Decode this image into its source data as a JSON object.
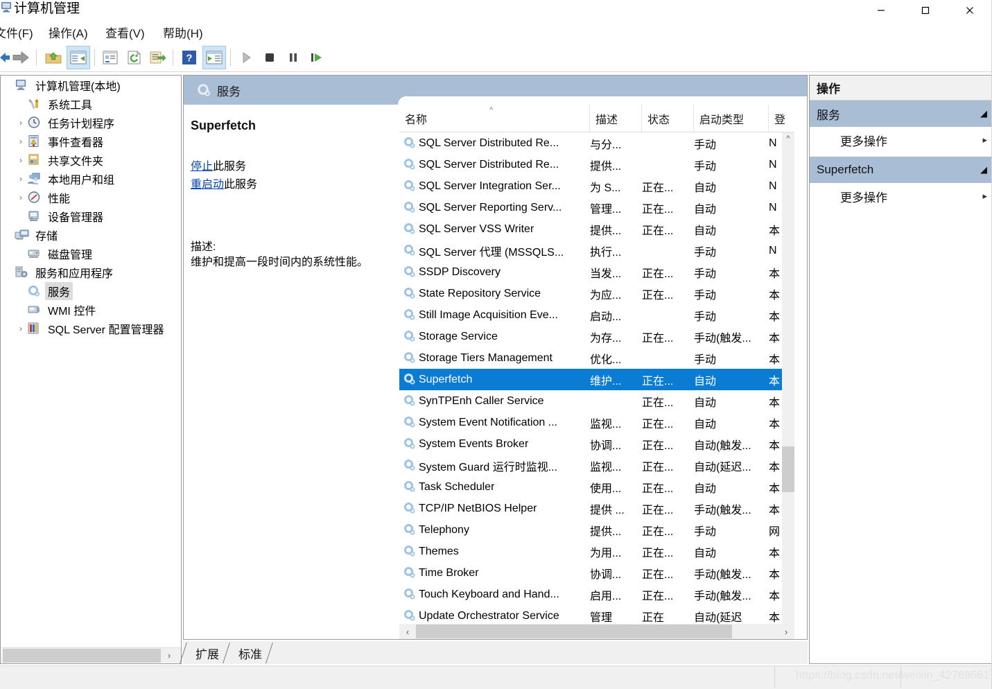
{
  "window": {
    "title": "计算机管理",
    "icon": "computer-management-icon",
    "minimize": "—",
    "maximize": "□",
    "close": "✕"
  },
  "menu": [
    {
      "label": "文件(F)",
      "name": "menu-file"
    },
    {
      "label": "操作(A)",
      "name": "menu-action"
    },
    {
      "label": "查看(V)",
      "name": "menu-view"
    },
    {
      "label": "帮助(H)",
      "name": "menu-help"
    }
  ],
  "toolbar": [
    {
      "icon": "back-arrow-icon",
      "active": false
    },
    {
      "icon": "forward-arrow-icon",
      "active": false
    },
    {
      "icon": "up-folder-icon",
      "active": false
    },
    {
      "icon": "show-hide-console-tree-icon",
      "active": true
    },
    {
      "icon": "properties-icon",
      "active": false
    },
    {
      "icon": "refresh-icon",
      "active": false
    },
    {
      "icon": "export-list-icon",
      "active": false
    },
    {
      "icon": "help-icon",
      "active": false
    },
    {
      "icon": "show-action-pane-icon",
      "active": true
    },
    {
      "icon": "start-service-icon",
      "active": false
    },
    {
      "icon": "stop-service-icon",
      "active": false
    },
    {
      "icon": "pause-service-icon",
      "active": false
    },
    {
      "icon": "restart-service-icon",
      "active": false
    }
  ],
  "tree": {
    "root": {
      "label": "计算机管理(本地)",
      "icon": "computer-icon",
      "indent": 0,
      "twisty": "",
      "selected": false
    },
    "items": [
      {
        "label": "系统工具",
        "icon": "system-tools-icon",
        "indent": 1,
        "twisty": "",
        "selected": false
      },
      {
        "label": "任务计划程序",
        "icon": "task-scheduler-icon",
        "indent": 2,
        "twisty": "›",
        "selected": false
      },
      {
        "label": "事件查看器",
        "icon": "event-viewer-icon",
        "indent": 2,
        "twisty": "›",
        "selected": false
      },
      {
        "label": "共享文件夹",
        "icon": "shared-folders-icon",
        "indent": 2,
        "twisty": "›",
        "selected": false
      },
      {
        "label": "本地用户和组",
        "icon": "local-users-groups-icon",
        "indent": 2,
        "twisty": "›",
        "selected": false
      },
      {
        "label": "性能",
        "icon": "performance-icon",
        "indent": 2,
        "twisty": "›",
        "selected": false
      },
      {
        "label": "设备管理器",
        "icon": "device-manager-icon",
        "indent": 2,
        "twisty": "",
        "selected": false
      },
      {
        "label": "存储",
        "icon": "storage-icon",
        "indent": 1,
        "twisty": "",
        "selected": false
      },
      {
        "label": "磁盘管理",
        "icon": "disk-management-icon",
        "indent": 2,
        "twisty": "",
        "selected": false
      },
      {
        "label": "服务和应用程序",
        "icon": "services-applications-icon",
        "indent": 1,
        "twisty": "",
        "selected": false
      },
      {
        "label": "服务",
        "icon": "services-icon",
        "indent": 2,
        "twisty": "",
        "selected": true
      },
      {
        "label": "WMI 控件",
        "icon": "wmi-control-icon",
        "indent": 2,
        "twisty": "",
        "selected": false
      },
      {
        "label": "SQL Server 配置管理器",
        "icon": "sql-server-config-icon",
        "indent": 2,
        "twisty": "›",
        "selected": false
      }
    ]
  },
  "center": {
    "header_title": "服务",
    "header_icon": "services-icon",
    "detail": {
      "service_name": "Superfetch",
      "stop_link": "停止",
      "stop_suffix": "此服务",
      "restart_link": "重启动",
      "restart_suffix": "此服务",
      "description_label": "描述:",
      "description_text": "维护和提高一段时间内的系统性能。"
    },
    "columns": [
      {
        "label": "名称",
        "name": "column-name",
        "sorted": "asc"
      },
      {
        "label": "描述",
        "name": "column-description"
      },
      {
        "label": "状态",
        "name": "column-status"
      },
      {
        "label": "启动类型",
        "name": "column-startup-type"
      },
      {
        "label": "登",
        "name": "column-logon-as"
      }
    ],
    "sort_caret": "^",
    "rows": [
      {
        "name": "SQL Server Distributed Re...",
        "desc": "与分...",
        "state": "",
        "start": "手动",
        "logon": "N",
        "selected": false
      },
      {
        "name": "SQL Server Distributed Re...",
        "desc": "提供...",
        "state": "",
        "start": "手动",
        "logon": "N",
        "selected": false
      },
      {
        "name": "SQL Server Integration Ser...",
        "desc": "为 S...",
        "state": "正在...",
        "start": "自动",
        "logon": "N",
        "selected": false
      },
      {
        "name": "SQL Server Reporting Serv...",
        "desc": "管理...",
        "state": "正在...",
        "start": "自动",
        "logon": "N",
        "selected": false
      },
      {
        "name": "SQL Server VSS Writer",
        "desc": "提供...",
        "state": "正在...",
        "start": "自动",
        "logon": "本",
        "selected": false
      },
      {
        "name": "SQL Server 代理 (MSSQLS...",
        "desc": "执行...",
        "state": "",
        "start": "手动",
        "logon": "N",
        "selected": false
      },
      {
        "name": "SSDP Discovery",
        "desc": "当发...",
        "state": "正在...",
        "start": "手动",
        "logon": "本",
        "selected": false
      },
      {
        "name": "State Repository Service",
        "desc": "为应...",
        "state": "正在...",
        "start": "手动",
        "logon": "本",
        "selected": false
      },
      {
        "name": "Still Image Acquisition Eve...",
        "desc": "启动...",
        "state": "",
        "start": "手动",
        "logon": "本",
        "selected": false
      },
      {
        "name": "Storage Service",
        "desc": "为存...",
        "state": "正在...",
        "start": "手动(触发...",
        "logon": "本",
        "selected": false
      },
      {
        "name": "Storage Tiers Management",
        "desc": "优化...",
        "state": "",
        "start": "手动",
        "logon": "本",
        "selected": false
      },
      {
        "name": "Superfetch",
        "desc": "维护...",
        "state": "正在...",
        "start": "自动",
        "logon": "本",
        "selected": true
      },
      {
        "name": "SynTPEnh Caller Service",
        "desc": "",
        "state": "正在...",
        "start": "自动",
        "logon": "本",
        "selected": false
      },
      {
        "name": "System Event Notification ...",
        "desc": "监视...",
        "state": "正在...",
        "start": "自动",
        "logon": "本",
        "selected": false
      },
      {
        "name": "System Events Broker",
        "desc": "协调...",
        "state": "正在...",
        "start": "自动(触发...",
        "logon": "本",
        "selected": false
      },
      {
        "name": "System Guard 运行时监视...",
        "desc": "监视...",
        "state": "正在...",
        "start": "自动(延迟...",
        "logon": "本",
        "selected": false
      },
      {
        "name": "Task Scheduler",
        "desc": "使用...",
        "state": "正在...",
        "start": "自动",
        "logon": "本",
        "selected": false
      },
      {
        "name": "TCP/IP NetBIOS Helper",
        "desc": "提供 ...",
        "state": "正在...",
        "start": "手动(触发...",
        "logon": "本",
        "selected": false
      },
      {
        "name": "Telephony",
        "desc": "提供...",
        "state": "正在...",
        "start": "手动",
        "logon": "网",
        "selected": false
      },
      {
        "name": "Themes",
        "desc": "为用...",
        "state": "正在...",
        "start": "自动",
        "logon": "本",
        "selected": false
      },
      {
        "name": "Time Broker",
        "desc": "协调...",
        "state": "正在...",
        "start": "手动(触发...",
        "logon": "本",
        "selected": false
      },
      {
        "name": "Touch Keyboard and Hand...",
        "desc": "启用...",
        "state": "正在...",
        "start": "手动(触发...",
        "logon": "本",
        "selected": false
      },
      {
        "name": "Update Orchestrator Service",
        "desc": "管理",
        "state": "正在",
        "start": "自动(延迟",
        "logon": "本",
        "selected": false
      }
    ],
    "scroll": {
      "up_arrow": "^",
      "down_arrow": "⌄",
      "left_arrow": "‹",
      "right_arrow": "›"
    }
  },
  "tabs": [
    {
      "label": "扩展",
      "name": "tab-extended",
      "active": true
    },
    {
      "label": "标准",
      "name": "tab-standard",
      "active": false
    }
  ],
  "actions": {
    "header": "操作",
    "groups": [
      {
        "title": "服务",
        "collapse_icon": "◢",
        "items": [
          {
            "label": "更多操作",
            "submenu_icon": "▸"
          }
        ]
      },
      {
        "title": "Superfetch",
        "collapse_icon": "◢",
        "items": [
          {
            "label": "更多操作",
            "submenu_icon": "▸"
          }
        ]
      }
    ]
  },
  "statusbar": {
    "watermark": "https://blog.csdn.net/weixin_42769561"
  },
  "colors": {
    "selection": "#0a7cd4",
    "header_band": "#a9bdd5",
    "link": "#0645ad",
    "toolbar_active": "#cfe5f7"
  }
}
